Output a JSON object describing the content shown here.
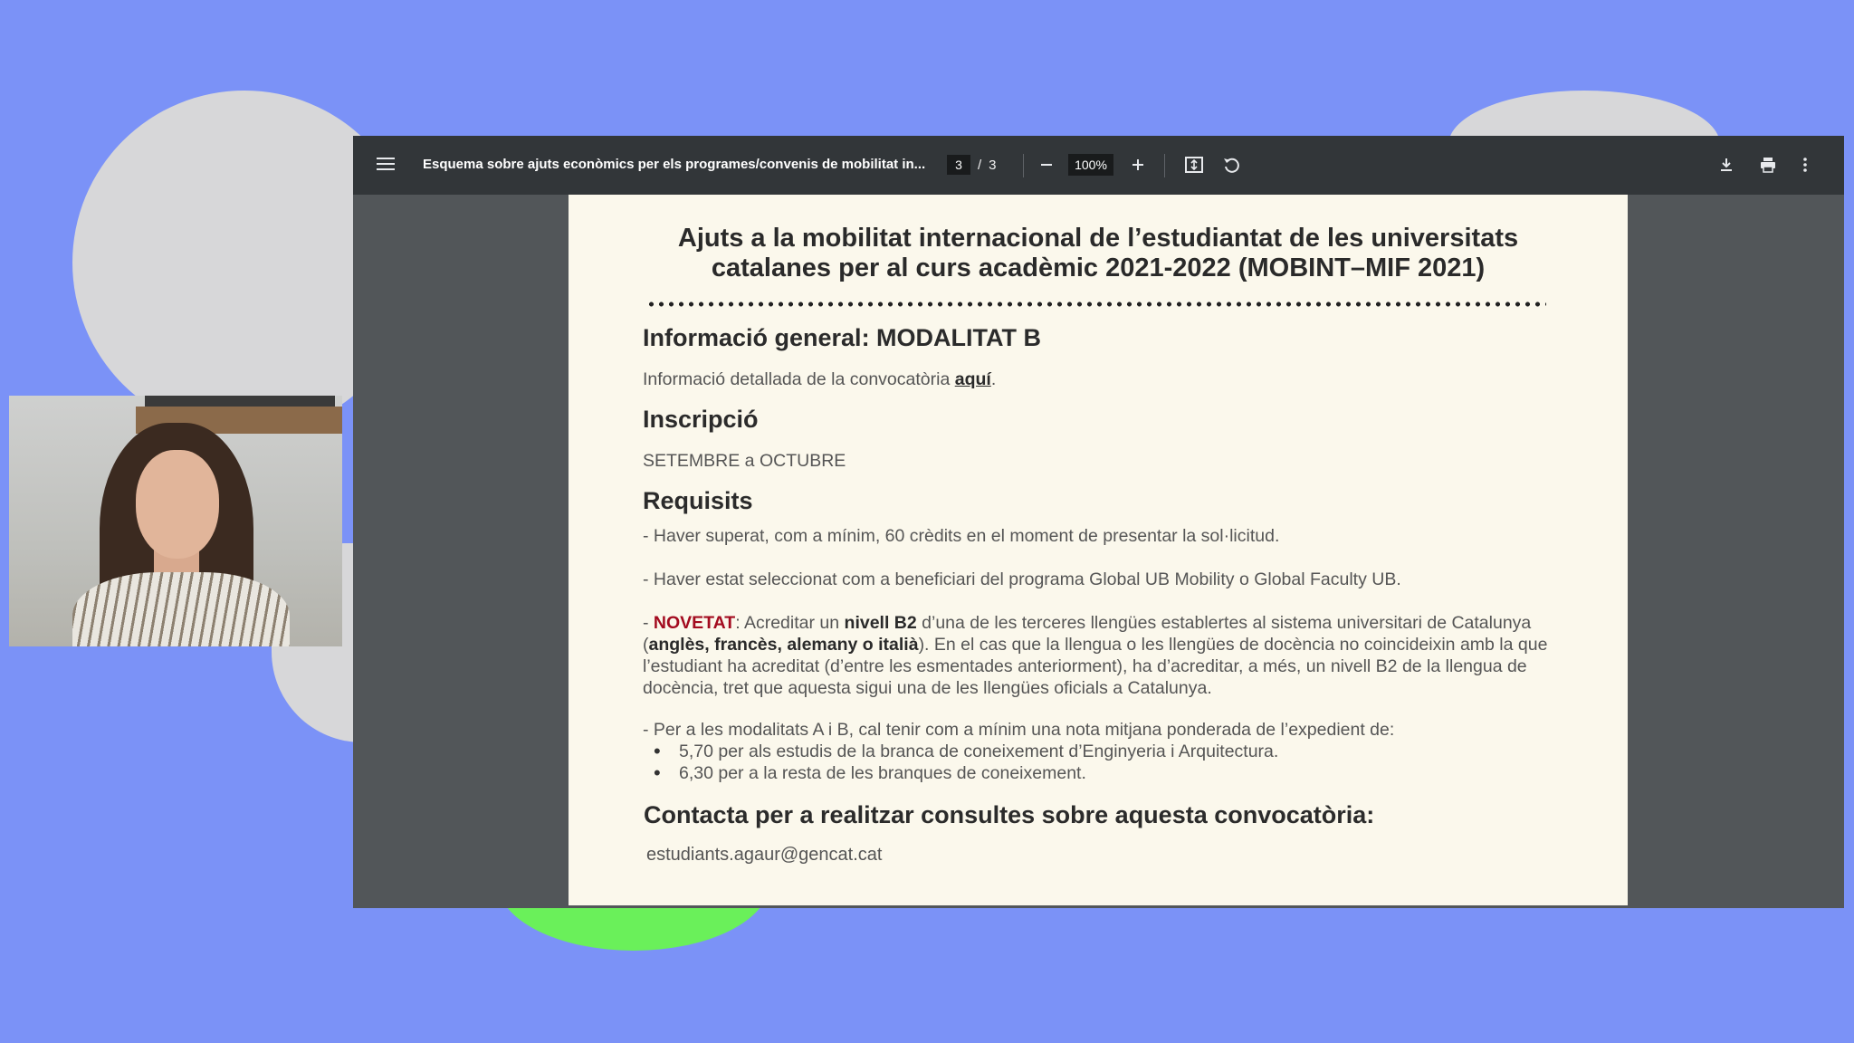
{
  "viewer": {
    "title": "Esquema sobre ajuts econòmics per els programes/convenis de mobilitat in...",
    "current_page": "3",
    "page_separator": "/",
    "total_pages": "3",
    "zoom": "100%",
    "icons": {
      "menu": "menu-icon",
      "zoom_out": "minus-icon",
      "zoom_in": "plus-icon",
      "fit": "fit-page-icon",
      "rotate": "rotate-icon",
      "download": "download-icon",
      "print": "print-icon",
      "more": "more-vert-icon"
    }
  },
  "document": {
    "title_line1": "Ajuts a la mobilitat internacional de l’estudiantat de les universitats",
    "title_line2": "catalanes per al curs acadèmic 2021-2022 (MOBINT–MIF 2021)",
    "general_heading": "Informació general: MODALITAT B",
    "general_text": "Informació detallada de la convocatòria ",
    "general_link": "aquí",
    "general_end": ".",
    "inscripcio_heading": "Inscripció",
    "inscripcio_text": "SETEMBRE a OCTUBRE",
    "requisits_heading": "Requisits",
    "req1": "- Haver superat, com a mínim, 60 crèdits en el moment de presentar la sol·licitud.",
    "req2": "- Haver estat seleccionat com a beneficiari del programa Global UB Mobility o Global Faculty UB.",
    "req3_dash": "- ",
    "req3_novetat": "NOVETAT",
    "req3_a": ": Acreditar un ",
    "req3_b2": "nivell B2",
    "req3_b": " d’una de les terceres llengües establertes al sistema universitari de Catalunya (",
    "req3_langs": "anglès, francès, alemany o italià",
    "req3_c": "). En el cas que la llengua o les llengües de docència no coincideixin amb la que l’estudiant ha acreditat (d’entre les esmentades anteriorment), ha d’acreditar, a més, un nivell B2 de la llengua de docència, tret que aquesta sigui una de les llengües oficials a Catalunya.",
    "req4": "- Per a les modalitats A i B, cal tenir com a mínim una nota mitjana ponderada de l’expedient de:",
    "bullet1": "5,70 per als estudis de la branca de coneixement d’Enginyeria i Arquitectura.",
    "bullet2": "6,30 per a la resta de les branques de coneixement.",
    "contact_heading": "Contacta per a realitzar consultes sobre aquesta convocatòria:",
    "email": "estudiants.agaur@gencat.cat"
  },
  "colors": {
    "background": "#7b92f7",
    "toolbar": "#323639",
    "viewer_bg": "#525659",
    "page": "#fbf8ec",
    "novetat": "#a30b1f"
  }
}
